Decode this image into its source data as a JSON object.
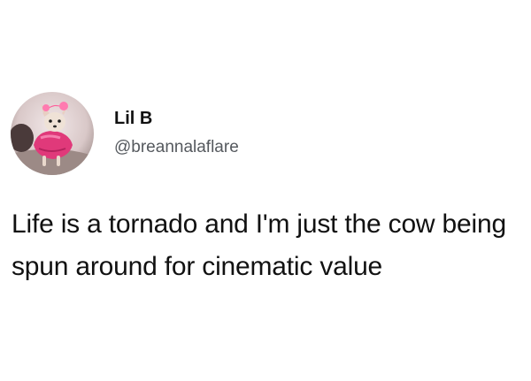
{
  "tweet": {
    "author": {
      "display_name": "Lil B",
      "handle": "@breannalaflare",
      "avatar": "profile-photo-dog-in-pink-outfit"
    },
    "text": "Life is a tornado and I'm just the cow being spun around for cinematic value"
  }
}
